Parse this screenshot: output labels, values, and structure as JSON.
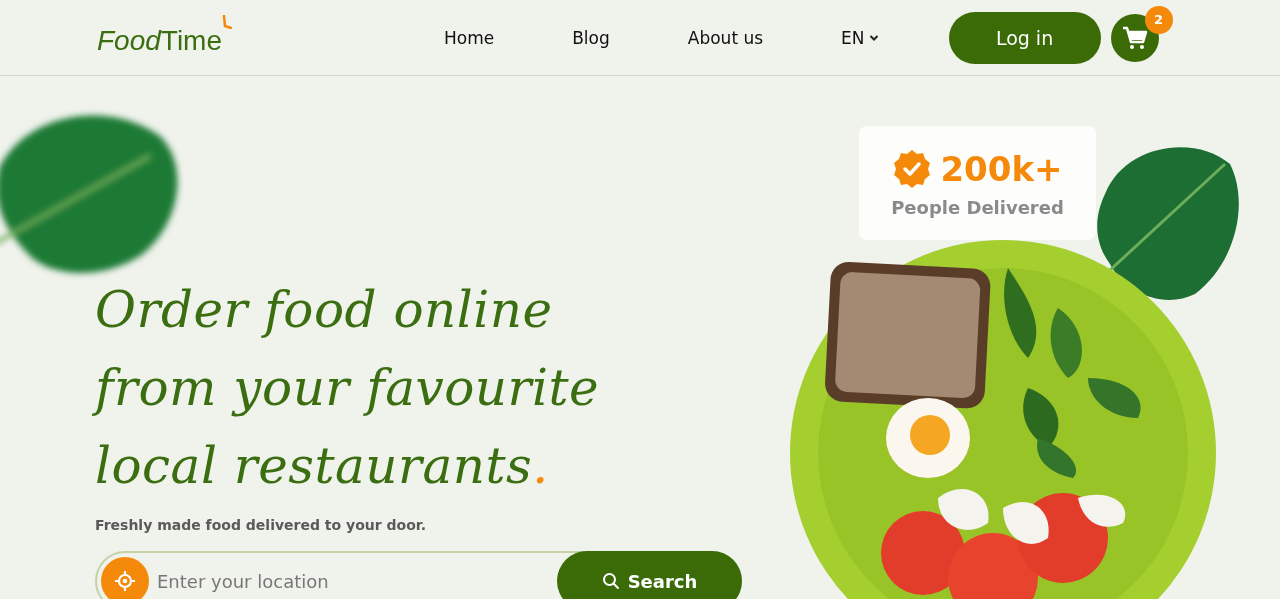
{
  "header": {
    "logo": {
      "italic_part": "Food",
      "regular_part": "Time"
    },
    "nav": [
      {
        "label": "Home"
      },
      {
        "label": "Blog"
      },
      {
        "label": "About us"
      }
    ],
    "language": "EN",
    "login_button": "Log in",
    "cart_count": "2"
  },
  "hero": {
    "headline_lines": [
      "Order food online",
      "from your favourite",
      "local restaurants"
    ],
    "headline_mark": ".",
    "subtitle": "Freshly made food delivered to your door.",
    "search": {
      "placeholder": "Enter your location",
      "button": "Search"
    }
  },
  "stat_card": {
    "value": "200k+",
    "label": "People Delivered"
  }
}
